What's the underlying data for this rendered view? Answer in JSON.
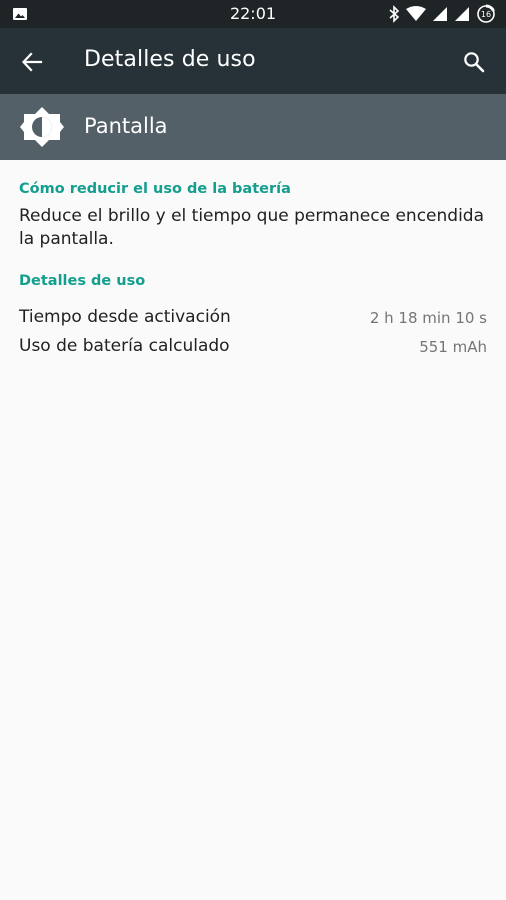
{
  "status_bar": {
    "time": "22:01",
    "battery_level": "16"
  },
  "app_bar": {
    "title": "Detalles de uso"
  },
  "header": {
    "title": "Pantalla"
  },
  "tip_section": {
    "title": "Cómo reducir el uso de la batería",
    "text": "Reduce el brillo y el tiempo que permanece encendida la pantalla."
  },
  "usage_section": {
    "title": "Detalles de uso",
    "rows": [
      {
        "label": "Tiempo desde activación",
        "value": "2 h 18 min 10 s"
      },
      {
        "label": "Uso de batería calculado",
        "value": "551 mAh"
      }
    ]
  },
  "colors": {
    "status_bar": "#1f2427",
    "app_bar": "#263238",
    "header_band": "#546068",
    "accent": "#139e8e",
    "background": "#fafafa"
  }
}
